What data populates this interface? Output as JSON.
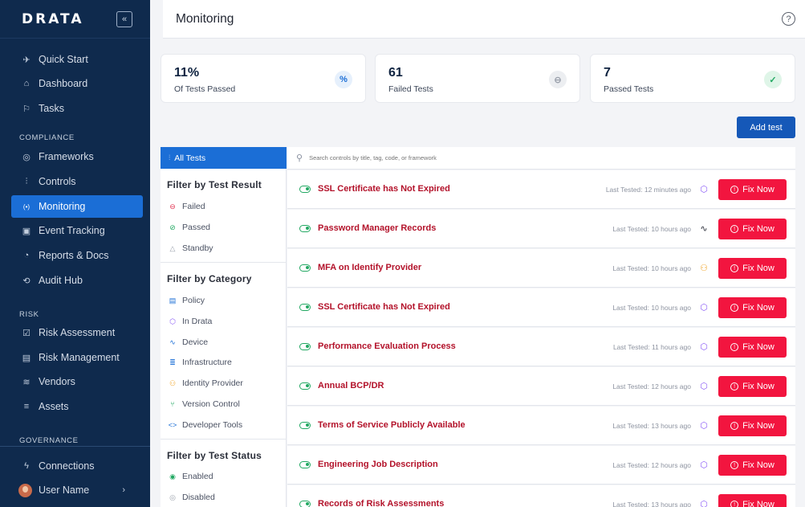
{
  "brand": {
    "logo": "DRATA",
    "collapse_icon": "«"
  },
  "sidebar": {
    "items_top": [
      {
        "label": "Quick Start",
        "icon": "rocket-icon",
        "glyph": "🚀"
      },
      {
        "label": "Dashboard",
        "icon": "home-icon",
        "glyph": "⌂"
      },
      {
        "label": "Tasks",
        "icon": "flag-icon",
        "glyph": "⚐"
      }
    ],
    "section_compliance": "COMPLIANCE",
    "items_compliance": [
      {
        "label": "Frameworks",
        "icon": "compass-icon",
        "glyph": "◎"
      },
      {
        "label": "Controls",
        "icon": "sliders-icon",
        "glyph": "⫶"
      },
      {
        "label": "Monitoring",
        "icon": "radar-icon",
        "glyph": "((•))",
        "active": true
      },
      {
        "label": "Event Tracking",
        "icon": "calendar-icon",
        "glyph": "▣"
      },
      {
        "label": "Reports & Docs",
        "icon": "pie-chart-icon",
        "glyph": "◔"
      },
      {
        "label": "Audit Hub",
        "icon": "audit-icon",
        "glyph": "⟲"
      }
    ],
    "section_risk": "RISK",
    "items_risk": [
      {
        "label": "Risk Assessment",
        "icon": "checkbox-icon",
        "glyph": "☑"
      },
      {
        "label": "Risk Management",
        "icon": "table-icon",
        "glyph": "▤"
      },
      {
        "label": "Vendors",
        "icon": "layers-icon",
        "glyph": "≋"
      },
      {
        "label": "Assets",
        "icon": "list-icon",
        "glyph": "≡"
      }
    ],
    "section_governance": "GOVERNANCE",
    "connections": {
      "label": "Connections",
      "glyph": "ϟ"
    },
    "user": {
      "label": "User Name",
      "chevron": "›"
    }
  },
  "header": {
    "title": "Monitoring",
    "help": "?"
  },
  "stats": [
    {
      "value": "11%",
      "label": "Of Tests Passed",
      "glyph": "%",
      "color": "#1b6ed6",
      "bg": "#e6f0fc"
    },
    {
      "value": "61",
      "label": "Failed Tests",
      "glyph": "⊖",
      "color": "#9aa0ab",
      "bg": "#eceef1"
    },
    {
      "value": "7",
      "label": "Passed Tests",
      "glyph": "✓",
      "color": "#22a862",
      "bg": "#dff5e8"
    }
  ],
  "add_test_label": "Add test",
  "filters": {
    "all_tests": "All Tests",
    "by_result_heading": "Filter by Test Result",
    "results": [
      {
        "label": "Failed",
        "glyph": "⊖",
        "color": "#e0314f"
      },
      {
        "label": "Passed",
        "glyph": "⊘",
        "color": "#22a862"
      },
      {
        "label": "Standby",
        "glyph": "△",
        "color": "#9aa0ab"
      }
    ],
    "by_category_heading": "Filter by Category",
    "categories": [
      {
        "label": "Policy",
        "glyph": "▤",
        "color": "#1b6ed6"
      },
      {
        "label": "In Drata",
        "glyph": "⬡",
        "color": "#8b5cf6"
      },
      {
        "label": "Device",
        "glyph": "∿",
        "color": "#1b6ed6"
      },
      {
        "label": "Infrastructure",
        "glyph": "≣",
        "color": "#1b6ed6"
      },
      {
        "label": "Identity Provider",
        "glyph": "⚇",
        "color": "#f0a52a"
      },
      {
        "label": "Version Control",
        "glyph": "⑂",
        "color": "#22a862"
      },
      {
        "label": "Developer Tools",
        "glyph": "<>",
        "color": "#1b6ed6"
      }
    ],
    "by_status_heading": "Filter by Test Status",
    "statuses": [
      {
        "label": "Enabled",
        "glyph": "◉",
        "color": "#22a862"
      },
      {
        "label": "Disabled",
        "glyph": "◎",
        "color": "#9aa0ab"
      }
    ]
  },
  "search": {
    "placeholder": "Search controls by title, tag, code, or framework"
  },
  "tests": [
    {
      "name": "SSL Certificate has Not Expired",
      "last_tested": "Last Tested: 12 minutes ago",
      "icon": "cube-icon",
      "glyph": "⬡",
      "color": "#8b5cf6"
    },
    {
      "name": "Password Manager Records",
      "last_tested": "Last Tested: 10 hours ago",
      "icon": "pulse-icon",
      "glyph": "∿",
      "color": "#2b2f3a"
    },
    {
      "name": "MFA on Identify Provider",
      "last_tested": "Last Tested: 10 hours ago",
      "icon": "users-icon",
      "glyph": "⚇",
      "color": "#f0a52a"
    },
    {
      "name": "SSL Certificate has Not Expired",
      "last_tested": "Last Tested: 10 hours ago",
      "icon": "cube-icon",
      "glyph": "⬡",
      "color": "#8b5cf6"
    },
    {
      "name": "Performance Evaluation Process",
      "last_tested": "Last Tested: 11 hours ago",
      "icon": "cube-icon",
      "glyph": "⬡",
      "color": "#8b5cf6"
    },
    {
      "name": "Annual BCP/DR",
      "last_tested": "Last Tested: 12 hours ago",
      "icon": "cube-icon",
      "glyph": "⬡",
      "color": "#8b5cf6"
    },
    {
      "name": "Terms of Service Publicly Available",
      "last_tested": "Last Tested: 13 hours ago",
      "icon": "cube-icon",
      "glyph": "⬡",
      "color": "#8b5cf6"
    },
    {
      "name": "Engineering Job Description",
      "last_tested": "Last Tested: 12 hours ago",
      "icon": "cube-icon",
      "glyph": "⬡",
      "color": "#8b5cf6"
    },
    {
      "name": "Records of Risk Assessments",
      "last_tested": "Last Tested: 13 hours ago",
      "icon": "cube-icon",
      "glyph": "⬡",
      "color": "#8b5cf6"
    }
  ],
  "fix_label": "Fix Now",
  "fix_glyph": "!"
}
